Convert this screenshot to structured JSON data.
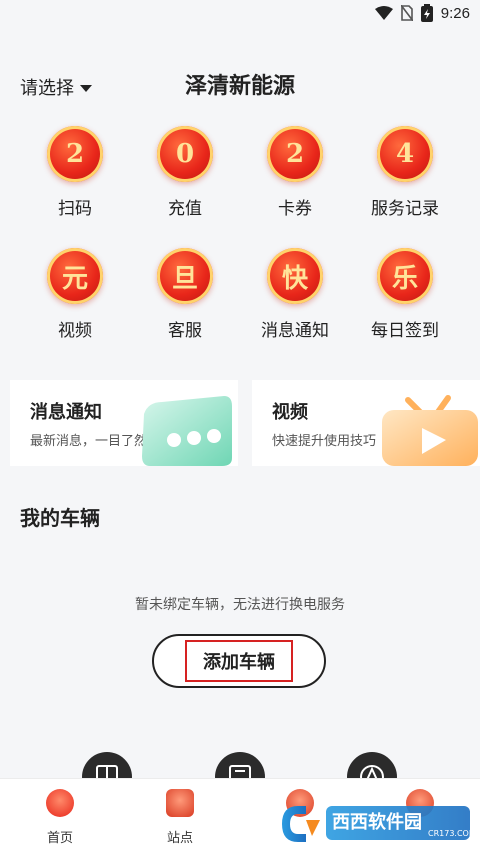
{
  "status": {
    "time": "9:26"
  },
  "header": {
    "region_label": "请选择",
    "title": "泽清新能源"
  },
  "grid": [
    {
      "glyph": "2",
      "label": "扫码"
    },
    {
      "glyph": "0",
      "label": "充值"
    },
    {
      "glyph": "2",
      "label": "卡券"
    },
    {
      "glyph": "4",
      "label": "服务记录"
    },
    {
      "glyph": "元",
      "label": "视频"
    },
    {
      "glyph": "旦",
      "label": "客服"
    },
    {
      "glyph": "快",
      "label": "消息通知"
    },
    {
      "glyph": "乐",
      "label": "每日签到"
    }
  ],
  "cards": [
    {
      "title": "消息通知",
      "subtitle": "最新消息，一目了然"
    },
    {
      "title": "视频",
      "subtitle": "快速提升使用技巧"
    }
  ],
  "vehicles": {
    "title": "我的车辆",
    "empty_text": "暂未绑定车辆，无法进行换电服务",
    "add_button": "添加车辆"
  },
  "tabbar": [
    {
      "label": "首页"
    },
    {
      "label": "站点"
    },
    {
      "label": ""
    },
    {
      "label": ""
    }
  ],
  "watermark": {
    "brand": "西西软件园",
    "site": "CR173.COM"
  },
  "colors": {
    "accent_red": "#e8261a",
    "gold": "#ffd36b"
  }
}
